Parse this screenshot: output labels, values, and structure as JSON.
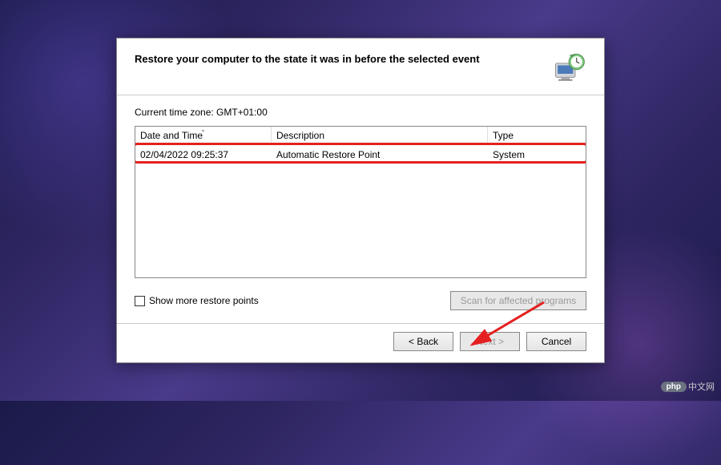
{
  "heading": "Restore your computer to the state it was in before the selected event",
  "timezone_label": "Current time zone: GMT+01:00",
  "table": {
    "columns": {
      "datetime": "Date and Time",
      "description": "Description",
      "type": "Type"
    },
    "rows": [
      {
        "datetime": "02/04/2022 09:25:37",
        "description": "Automatic Restore Point",
        "type": "System"
      }
    ]
  },
  "checkbox_label": "Show more restore points",
  "buttons": {
    "scan": "Scan for affected programs",
    "back": "< Back",
    "next": "Next >",
    "cancel": "Cancel"
  },
  "watermark": {
    "badge": "php",
    "text": "中文网"
  }
}
